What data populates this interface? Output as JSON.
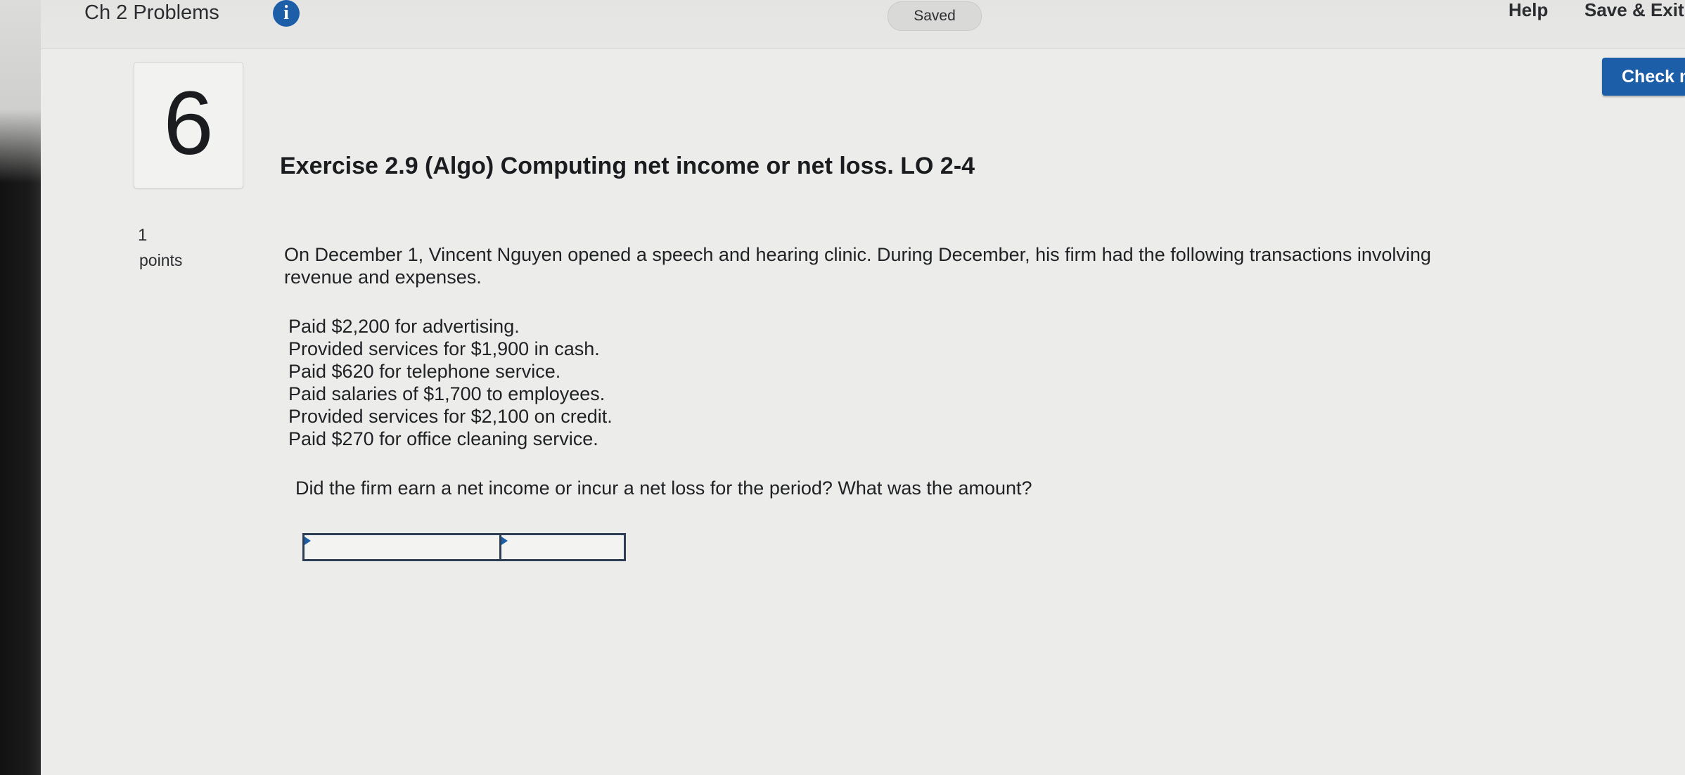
{
  "header": {
    "assignment_title": "Ch 2 Problems",
    "info_icon_glyph": "i",
    "status": "Saved",
    "help_label": "Help",
    "save_exit_label": "Save & Exit",
    "check_label": "Check my work",
    "accent_color": "#1d5ea8"
  },
  "question": {
    "number": "6",
    "points_value": "1",
    "points_label": "points",
    "heading": "Exercise 2.9 (Algo) Computing net income or net loss. LO 2-4",
    "prompt": "On December 1, Vincent Nguyen opened a speech and hearing clinic. During December, his firm had the following transactions involving revenue and expenses.",
    "transactions": [
      "Paid $2,200 for advertising.",
      "Provided services for $1,900 in cash.",
      "Paid $620 for telephone service.",
      "Paid salaries of $1,700 to employees.",
      "Provided services for $2,100 on credit.",
      "Paid $270 for office cleaning service."
    ],
    "question_text": "Did the firm earn a net income or incur a net loss for the period? What was the amount?"
  }
}
